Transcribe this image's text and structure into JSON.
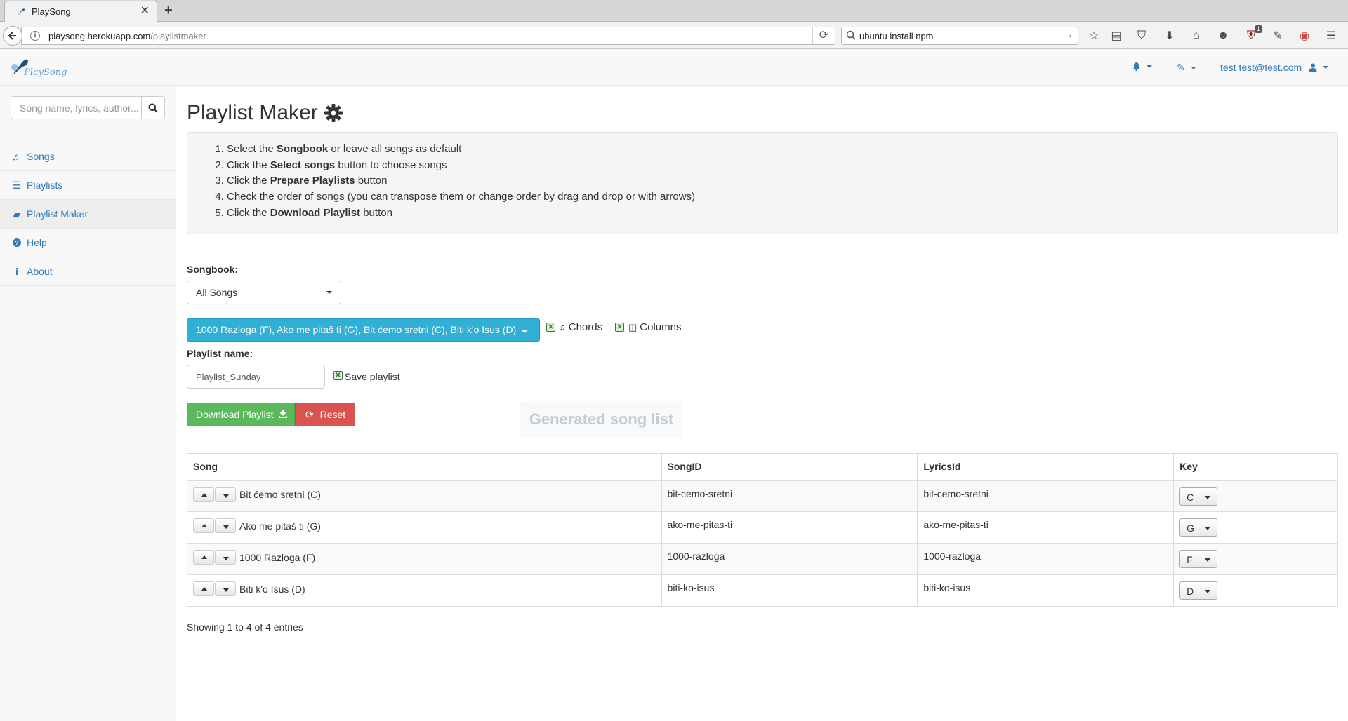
{
  "browser": {
    "tab_title": "PlaySong",
    "url_host": "playsong.herokuapp.com",
    "url_path": "/playlistmaker",
    "search_value": "ubuntu install npm",
    "addon_badge": "1"
  },
  "header": {
    "logo_text": "PlaySong",
    "user": "test test@test.com"
  },
  "sidebar": {
    "search_placeholder": "Song name, lyrics, author...",
    "items": [
      {
        "label": "Songs"
      },
      {
        "label": "Playlists"
      },
      {
        "label": "Playlist Maker"
      },
      {
        "label": "Help"
      },
      {
        "label": "About"
      }
    ]
  },
  "main": {
    "title": "Playlist Maker",
    "steps": [
      {
        "a": "Select the ",
        "b": "Songbook",
        "c": " or leave all songs as default"
      },
      {
        "a": "Click the ",
        "b": "Select songs",
        "c": " button to choose songs"
      },
      {
        "a": "Click the ",
        "b": "Prepare Playlists",
        "c": " button"
      },
      {
        "a": "Check the order of songs (you can transpose them or change order by drag and drop or with arrows)",
        "b": "",
        "c": ""
      },
      {
        "a": "Click the ",
        "b": "Download Playlist",
        "c": " button"
      }
    ],
    "songbook_label": "Songbook:",
    "songbook_value": "All Songs",
    "selected_songs": "1000 Razloga (F), Ako me pitaš ti (G), Bit ćemo sretni (C), Biti k'o Isus (D)",
    "chords_label": "Chords",
    "columns_label": "Columns",
    "playlist_name_label": "Playlist name:",
    "playlist_name_value": "Playlist_Sunday",
    "save_playlist_label": "Save playlist",
    "download_label": "Download Playlist",
    "reset_label": "Reset",
    "generated_label": "Generated song list",
    "table": {
      "headers": {
        "song": "Song",
        "songid": "SongID",
        "lyricsid": "LyricsId",
        "key": "Key"
      },
      "rows": [
        {
          "song": "Bit ćemo sretni (C)",
          "songid": "bit-cemo-sretni",
          "lyricsid": "bit-cemo-sretni",
          "key": "C"
        },
        {
          "song": "Ako me pitaš ti (G)",
          "songid": "ako-me-pitas-ti",
          "lyricsid": "ako-me-pitas-ti",
          "key": "G"
        },
        {
          "song": "1000 Razloga (F)",
          "songid": "1000-razloga",
          "lyricsid": "1000-razloga",
          "key": "F"
        },
        {
          "song": "Biti k'o Isus (D)",
          "songid": "biti-ko-isus",
          "lyricsid": "biti-ko-isus",
          "key": "D"
        }
      ]
    },
    "footer_info": "Showing 1 to 4 of 4 entries"
  },
  "colors": {
    "link": "#337ab7",
    "info_button": "#31b0d5",
    "success_button": "#5cb85c",
    "danger_button": "#d9534f"
  }
}
